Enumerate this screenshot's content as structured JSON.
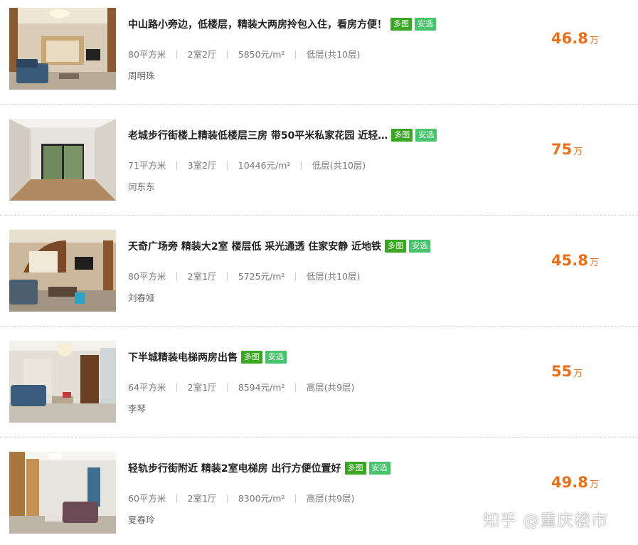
{
  "listings": [
    {
      "title": "中山路小旁边，低楼层，精装大两房拎包入住，看房方便！",
      "tags": {
        "multi": "多图",
        "safe": "安选"
      },
      "area": "80平方米",
      "layout": "2室2厅",
      "unit_price": "5850元/m²",
      "floor": "低层(共10层)",
      "agent": "周明珠",
      "price": "46.8",
      "price_unit": "万"
    },
    {
      "title": "老城步行街楼上精装低楼层三房 带50平米私家花园 近轻…",
      "tags": {
        "multi": "多图",
        "safe": "安选"
      },
      "area": "71平方米",
      "layout": "3室2厅",
      "unit_price": "10446元/m²",
      "floor": "低层(共10层)",
      "agent": "闫东东",
      "price": "75",
      "price_unit": "万"
    },
    {
      "title": "天奇广场旁 精装大2室 楼层低 采光通透 住家安静 近地铁",
      "tags": {
        "multi": "多图",
        "safe": "安选"
      },
      "area": "80平方米",
      "layout": "2室1厅",
      "unit_price": "5725元/m²",
      "floor": "低层(共10层)",
      "agent": "刘春娅",
      "price": "45.8",
      "price_unit": "万"
    },
    {
      "title": "下半城精装电梯两房出售",
      "tags": {
        "multi": "多图",
        "safe": "安选"
      },
      "area": "64平方米",
      "layout": "2室1厅",
      "unit_price": "8594元/m²",
      "floor": "高层(共9层)",
      "agent": "李琴",
      "price": "55",
      "price_unit": "万"
    },
    {
      "title": "轻轨步行街附近 精装2室电梯房 出行方便位置好",
      "tags": {
        "multi": "多图",
        "safe": "安选"
      },
      "area": "60平方米",
      "layout": "2室1厅",
      "unit_price": "8300元/m²",
      "floor": "高层(共9层)",
      "agent": "夏春玲",
      "price": "49.8",
      "price_unit": "万"
    }
  ],
  "watermark": "知乎 @重庆楼市",
  "colors": {
    "price": "#e8701a",
    "tag_multi": "#3aa624",
    "tag_safe": "#47c56c",
    "divider": "#d4d4d4"
  }
}
